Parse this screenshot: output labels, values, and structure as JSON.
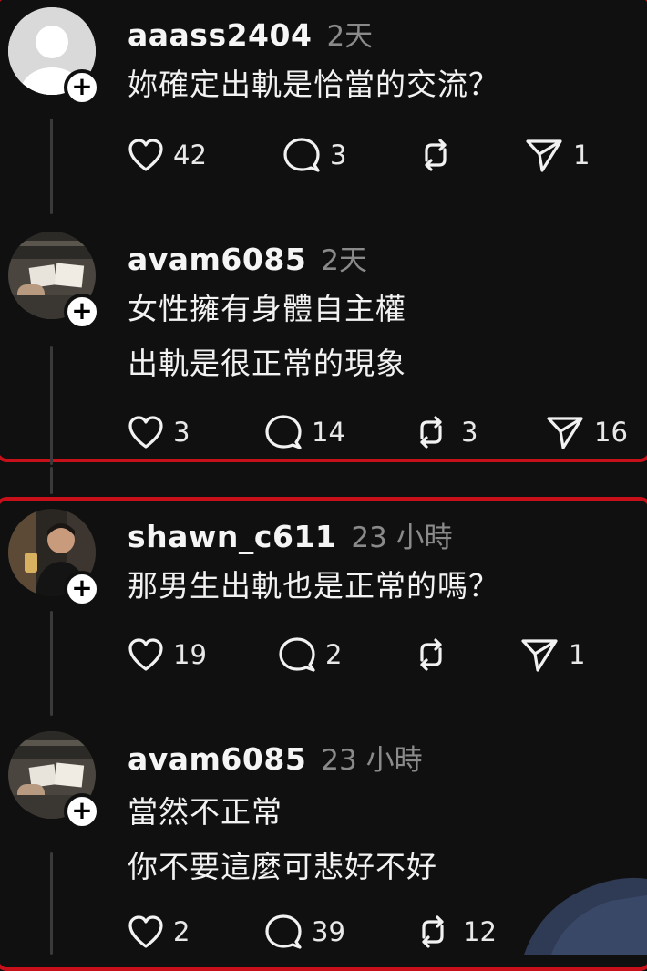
{
  "colors": {
    "background": "#101010",
    "highlight": "#c8101a",
    "timestamp": "#8a8a8a"
  },
  "posts": [
    {
      "username": "aaass2404",
      "timestamp": "2天",
      "lines": [
        "妳確定出軌是恰當的交流？"
      ],
      "likes": "42",
      "replies": "3",
      "reposts": "",
      "shares": "1",
      "avatar": "default-avatar-icon"
    },
    {
      "username": "avam6085",
      "timestamp": "2天",
      "lines": [
        "女性擁有身體自主權",
        "出軌是很正常的現象"
      ],
      "likes": "3",
      "replies": "14",
      "reposts": "3",
      "shares": "16",
      "avatar": "photo-avatar"
    },
    {
      "username": "shawn_c611",
      "timestamp": "23 小時",
      "lines": [
        "那男生出軌也是正常的嗎？"
      ],
      "likes": "19",
      "replies": "2",
      "reposts": "",
      "shares": "1",
      "avatar": "photo-avatar"
    },
    {
      "username": "avam6085",
      "timestamp": "23 小時",
      "lines": [
        "當然不正常",
        "你不要這麼可悲好不好"
      ],
      "likes": "2",
      "replies": "39",
      "reposts": "12",
      "shares": "",
      "avatar": "photo-avatar"
    }
  ]
}
